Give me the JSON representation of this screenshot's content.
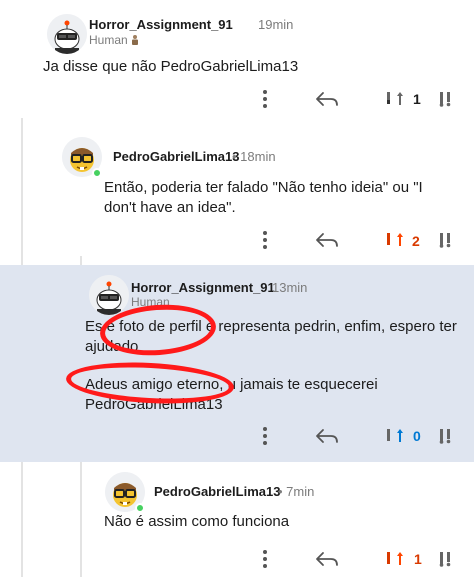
{
  "comments": [
    {
      "username": "Horror_Assignment_91",
      "time": "19min",
      "flair": "Human",
      "flair_icon": "person-icon",
      "text": "Ja disse que não PedroGabrielLima13",
      "votes": "1",
      "vote_color": "#1c1c1c"
    },
    {
      "username": "PedroGabrielLima13",
      "time": "• 18min",
      "text": "Então, poderia ter falado \"Não tenho ideia\" ou \"I don't have an idea\".",
      "votes": "2",
      "vote_color": "#d93a00"
    },
    {
      "username": "Horror_Assignment_91",
      "time": "13min",
      "flair": "Human",
      "text_1": "Es e foto de perfil e representa pedrin, enfim, espero ter   ajudado",
      "text_2": "Adeus amigo eterno, u jamais te esquecerei PedroGabrielLima13",
      "votes": "0",
      "vote_color": "#0079d3"
    },
    {
      "username": "PedroGabrielLima13",
      "time": "• 7min",
      "text": "Não é assim como funciona",
      "votes": "1",
      "vote_color": "#d93a00"
    }
  ],
  "colors": {
    "highlight_bg": "#dfe5f0",
    "annotation_red": "#ff1a1a",
    "online_green": "#46d160"
  },
  "icons": [
    "more-vert-icon",
    "reply-icon",
    "upvote-icon",
    "downvote-icon",
    "snoo-avatar-icon",
    "nerd-avatar-icon"
  ]
}
